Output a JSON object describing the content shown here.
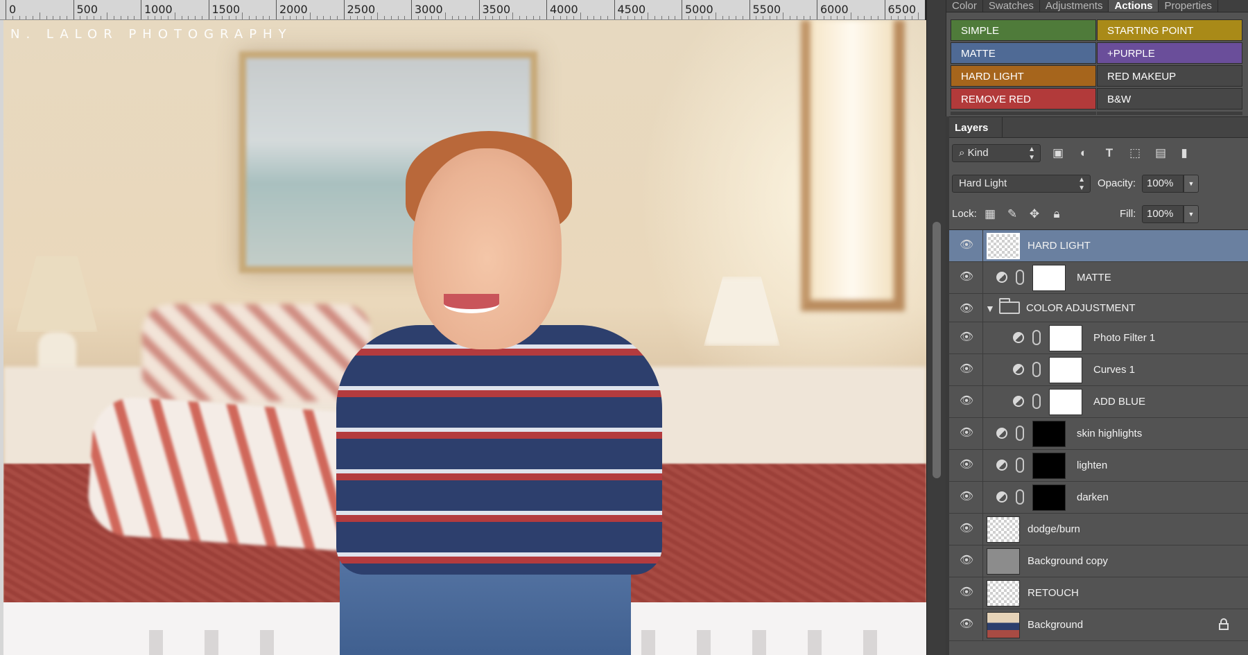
{
  "ruler": {
    "labels": [
      "0",
      "500",
      "1000",
      "1500",
      "2000",
      "2500",
      "3000",
      "3500",
      "4000",
      "4500",
      "5000",
      "5500",
      "6000",
      "6500"
    ]
  },
  "canvas": {
    "watermark": "N. LALOR PHOTOGRAPHY"
  },
  "panel_tabs": {
    "color": "Color",
    "swatches": "Swatches",
    "adjustments": "Adjustments",
    "actions": "Actions",
    "properties": "Properties"
  },
  "actions": {
    "buttons": [
      {
        "label": "SIMPLE",
        "color": "#4f7b3a"
      },
      {
        "label": "STARTING POINT",
        "color": "#a98a18"
      },
      {
        "label": "MATTE",
        "color": "#4f6a95"
      },
      {
        "label": "+PURPLE",
        "color": "#6a4e9a"
      },
      {
        "label": "HARD LIGHT",
        "color": "#a6651c"
      },
      {
        "label": "RED MAKEUP",
        "color": "#474747"
      },
      {
        "label": "REMOVE RED",
        "color": "#b23a3a"
      },
      {
        "label": "B&W",
        "color": "#474747"
      }
    ]
  },
  "layers_panel": {
    "title": "Layers",
    "filter": {
      "value": "Kind"
    },
    "blend_mode": {
      "value": "Hard Light"
    },
    "opacity": {
      "label": "Opacity:",
      "value": "100%"
    },
    "lock": {
      "label": "Lock:"
    },
    "fill": {
      "label": "Fill:",
      "value": "100%"
    },
    "layers": [
      {
        "name": "HARD LIGHT",
        "selected": true
      },
      {
        "name": "MATTE"
      },
      {
        "name": "COLOR ADJUSTMENT"
      },
      {
        "name": "Photo Filter 1"
      },
      {
        "name": "Curves 1"
      },
      {
        "name": "ADD BLUE"
      },
      {
        "name": "skin highlights"
      },
      {
        "name": "lighten"
      },
      {
        "name": "darken"
      },
      {
        "name": "dodge/burn"
      },
      {
        "name": "Background copy"
      },
      {
        "name": "RETOUCH"
      },
      {
        "name": "Background",
        "locked": true
      }
    ]
  }
}
